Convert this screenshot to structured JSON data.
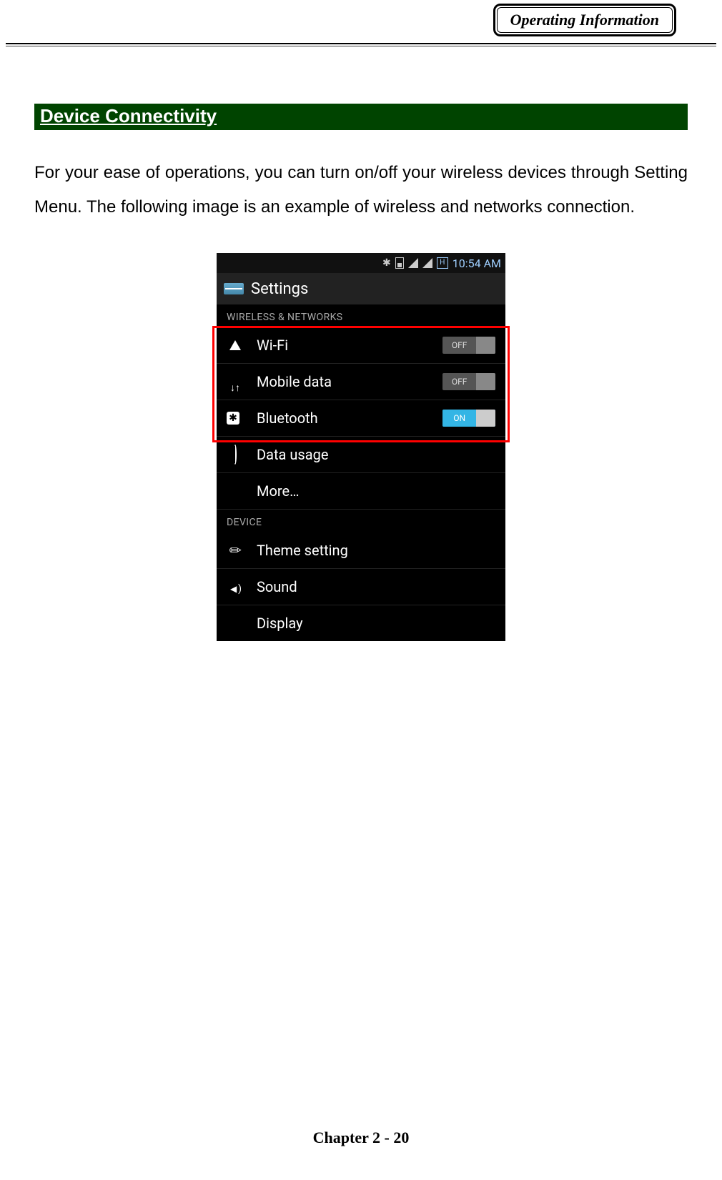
{
  "header": {
    "badge": "Operating Information"
  },
  "section": {
    "title": "Device Connectivity"
  },
  "paragraph": "For your ease of operations, you can turn on/off your wireless devices through Setting Menu. The following image is an example of wireless and networks connection.",
  "phone": {
    "statusbar": {
      "time": "10:54 AM",
      "hspa": "H"
    },
    "app_title": "Settings",
    "group_wireless": "WIRELESS & NETWORKS",
    "wifi": {
      "label": "Wi-Fi",
      "state": "OFF",
      "on": false
    },
    "mobile": {
      "label": "Mobile data",
      "state": "OFF",
      "on": false
    },
    "bluetooth": {
      "label": "Bluetooth",
      "state": "ON",
      "on": true
    },
    "data_usage": "Data usage",
    "more": "More…",
    "group_device": "DEVICE",
    "theme": "Theme setting",
    "sound": "Sound",
    "display": "Display"
  },
  "footer": "Chapter 2 - 20"
}
